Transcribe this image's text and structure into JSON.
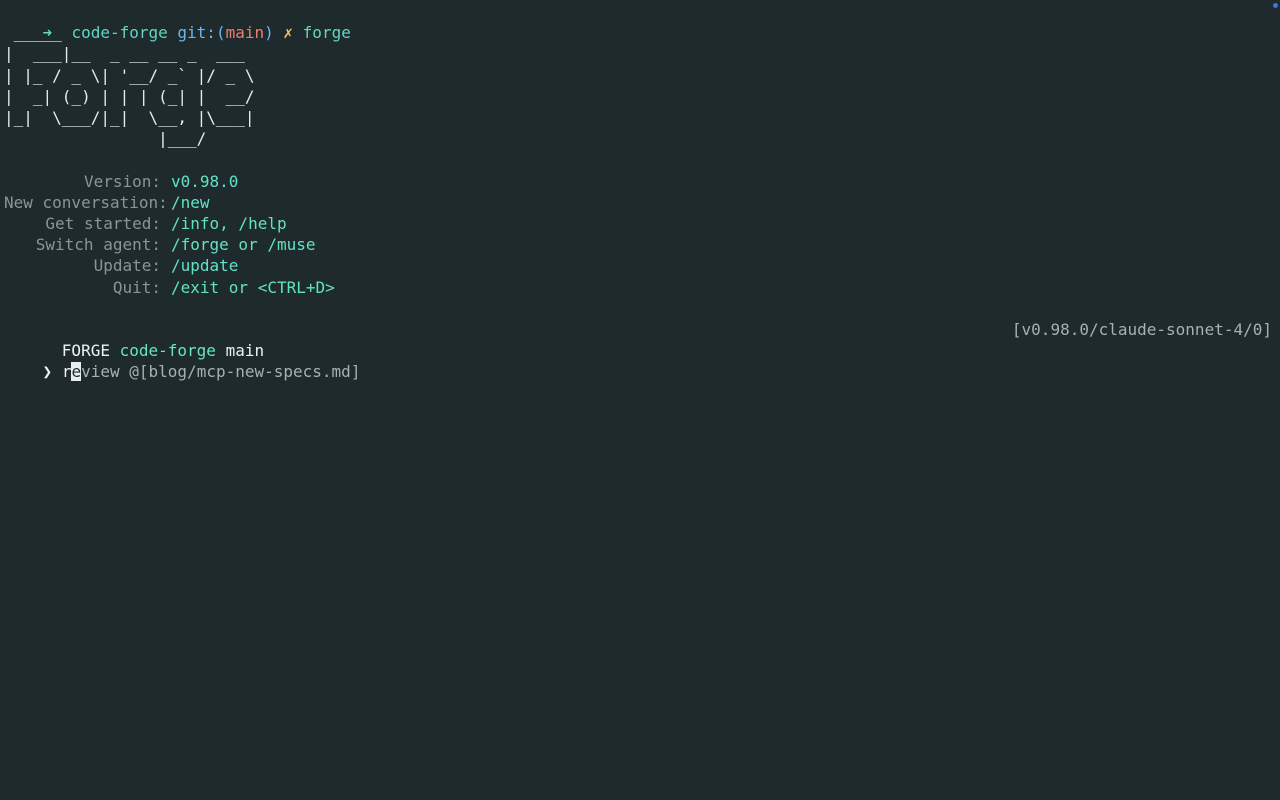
{
  "prompt": {
    "arrow": "➜",
    "dir": "code-forge",
    "git_label": "git:(",
    "branch": "main",
    "git_close": ")",
    "dirty_mark": "✗",
    "command": "forge"
  },
  "banner": {
    "ascii_art": " _____\n|  ___|__  _ __ __ _  ___\n| |_ / _ \\| '__/ _` |/ _ \\\n|  _| (_) | | | (_| |  __/\n|_|  \\___/|_|  \\__, |\\___|\n                |___/"
  },
  "info": [
    {
      "key": "Version:",
      "value": "v0.98.0"
    },
    {
      "key": "New conversation:",
      "value": "/new"
    },
    {
      "key": "Get started:",
      "value": "/info, /help"
    },
    {
      "key": "Switch agent:",
      "value": "/forge or /muse"
    },
    {
      "key": "Update:",
      "value": "/update"
    },
    {
      "key": "Quit:",
      "value": "/exit or <CTRL+D>"
    }
  ],
  "status": {
    "agent": "FORGE",
    "project": "code-forge",
    "branch": "main",
    "model_info": "[v0.98.0/claude-sonnet-4/0]"
  },
  "input": {
    "prompt_char": "❯",
    "before_cursor": "r",
    "cursor_char": "e",
    "after_cursor": "view @[blog/mcp-new-specs.md]"
  },
  "colors": {
    "background": "#1f2a2d",
    "accent": "#5fd7c3",
    "branch": "#f07c6e",
    "dirty": "#e8c55a",
    "indicator": "#3b74e6"
  }
}
